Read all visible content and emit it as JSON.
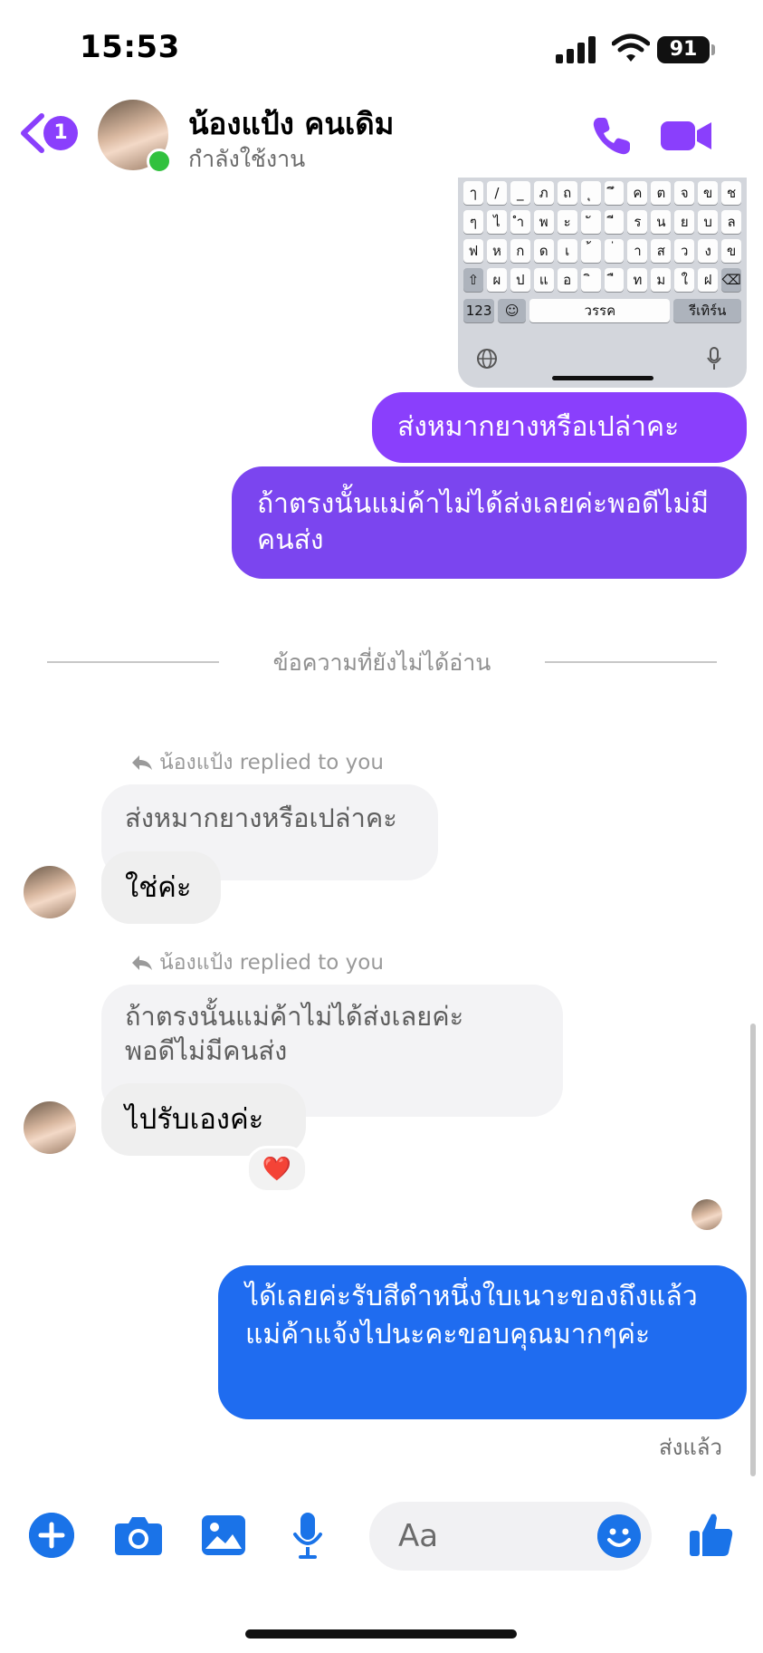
{
  "status_bar": {
    "time": "15:53",
    "battery": "91"
  },
  "header": {
    "back_badge": "1",
    "contact_name": "น้องแป้ง คนเดิม",
    "contact_status": "กำลังใช้งาน"
  },
  "keyboard_image": {
    "row1": [
      "ๅ",
      "/",
      "_",
      "ภ",
      "ถ",
      "ุ",
      "ึ",
      "ค",
      "ต",
      "จ",
      "ข",
      "ช"
    ],
    "row2": [
      "ๆ",
      "ไ",
      "ำ",
      "พ",
      "ะ",
      "ั",
      "ี",
      "ร",
      "น",
      "ย",
      "บ",
      "ล"
    ],
    "row3": [
      "ฟ",
      "ห",
      "ก",
      "ด",
      "เ",
      "้",
      "่",
      "า",
      "ส",
      "ว",
      "ง",
      "ข"
    ],
    "row4": [
      "⇧",
      "ผ",
      "ป",
      "แ",
      "อ",
      "ิ",
      "ื",
      "ท",
      "ม",
      "ใ",
      "ฝ",
      "⌫"
    ],
    "key_123": "123",
    "key_space": "วรรค",
    "key_return": "รีเทิร์น"
  },
  "messages": {
    "out_1": "ส่งหมากยางหรือเปล่าคะ",
    "out_2": "ถ้าตรงนั้นแม่ค้าไม่ได้ส่งเลยค่ะพอดีไม่มีคนส่ง",
    "unread_divider": "ข้อความที่ยังไม่ได้อ่าน",
    "reply_1_label": "น้องแป้ง replied to you",
    "reply_1_quote": "ส่งหมากยางหรือเปล่าคะ",
    "reply_1_text": "ใช่ค่ะ",
    "reply_2_label": "น้องแป้ง replied to you",
    "reply_2_quote": "ถ้าตรงนั้นแม่ค้าไม่ได้ส่งเลยค่ะพอดีไม่มีคนส่ง",
    "reply_2_text": "ไปรับเองค่ะ",
    "reaction": "❤️",
    "out_3": "ได้เลยค่ะรับสีดำหนึ่งใบเนาะของถึงแล้วแม่ค้าแจ้งไปนะคะขอบคุณมากๆค่ะ",
    "sent_status": "ส่งแล้ว"
  },
  "composer": {
    "placeholder": "Aa"
  },
  "colors": {
    "accent": "#8a3ffc",
    "outgoing_purple": "#7b45ef",
    "outgoing_blue": "#1f6cf0",
    "online": "#31c13e"
  },
  "icons": [
    "back-chevron-icon",
    "phone-icon",
    "video-camera-icon",
    "reply-arrow-icon",
    "plus-icon",
    "camera-icon",
    "photo-icon",
    "microphone-icon",
    "emoji-icon",
    "thumbs-up-icon"
  ]
}
